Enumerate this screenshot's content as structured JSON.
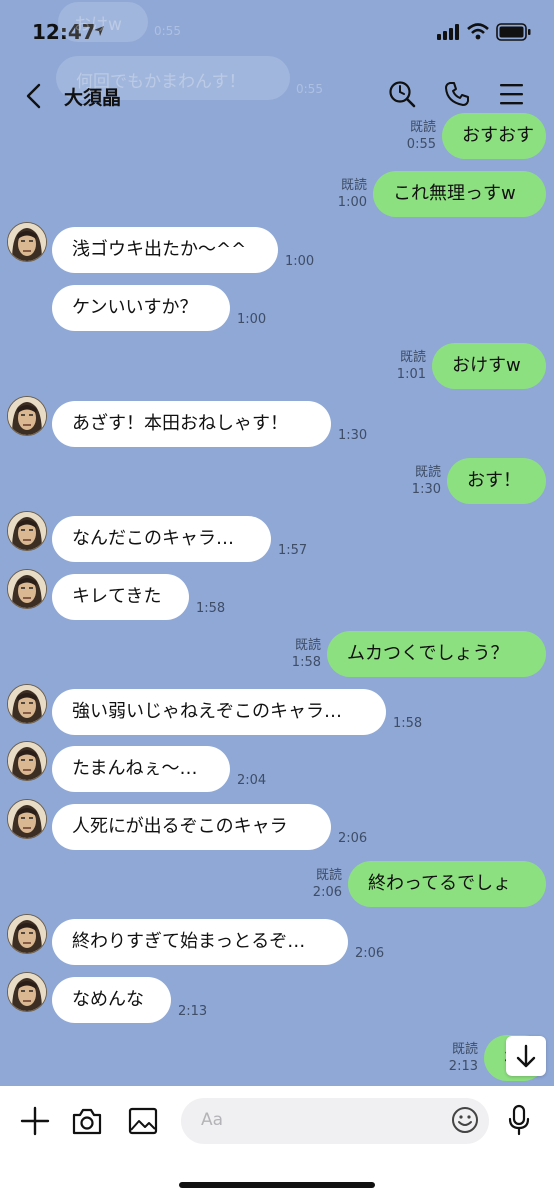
{
  "status": {
    "time": "12:47"
  },
  "header": {
    "title": "大須晶"
  },
  "ghost": {
    "line1": "おけw",
    "time1": "0:55",
    "line2": "何回でもかまわんす！",
    "time2": "0:55"
  },
  "messages": [
    {
      "side": "right",
      "text": "おすおす",
      "read": "既読",
      "time": "0:55"
    },
    {
      "side": "right",
      "text": "これ無理っすw",
      "read": "既読",
      "time": "1:00"
    },
    {
      "side": "left",
      "text": "浅ゴウキ出たか〜^^",
      "time": "1:00"
    },
    {
      "side": "left",
      "text": "ケンいいすか？",
      "time": "1:00"
    },
    {
      "side": "right",
      "text": "おけすw",
      "read": "既読",
      "time": "1:01"
    },
    {
      "side": "left",
      "text": "あざす！本田おねしゃす！",
      "time": "1:30"
    },
    {
      "side": "right",
      "text": "おす！",
      "read": "既読",
      "time": "1:30"
    },
    {
      "side": "left",
      "text": "なんだこのキャラ…",
      "time": "1:57"
    },
    {
      "side": "left",
      "text": "キレてきた",
      "time": "1:58"
    },
    {
      "side": "right",
      "text": "ムカつくでしょう？",
      "read": "既読",
      "time": "1:58"
    },
    {
      "side": "left",
      "text": "強い弱いじゃねえぞこのキャラ…",
      "time": "1:58"
    },
    {
      "side": "left",
      "text": "たまんねぇ〜…",
      "time": "2:04"
    },
    {
      "side": "left",
      "text": "人死にが出るぞこのキャラ",
      "time": "2:06"
    },
    {
      "side": "right",
      "text": "終わってるでしょ",
      "read": "既読",
      "time": "2:06"
    },
    {
      "side": "left",
      "text": "終わりすぎて始まっとるぞ…",
      "time": "2:06"
    },
    {
      "side": "left",
      "text": "なめんな",
      "time": "2:13"
    },
    {
      "side": "right",
      "text": "わろ",
      "read": "既読",
      "time": "2:13"
    }
  ],
  "input": {
    "placeholder": "Aa"
  },
  "colors": {
    "background": "#8fa8d6",
    "sent": "#8de07f",
    "received": "#ffffff"
  },
  "icons": [
    "back-icon",
    "search-icon",
    "phone-icon",
    "menu-icon",
    "plus-icon",
    "camera-icon",
    "image-icon",
    "emoji-icon",
    "mic-icon",
    "arrow-down-icon"
  ]
}
